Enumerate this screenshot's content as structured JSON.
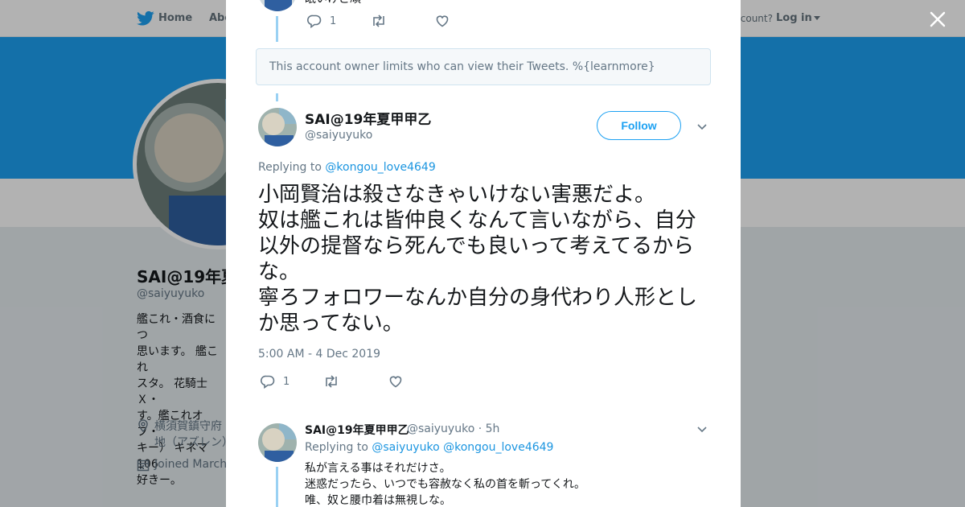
{
  "nav": {
    "home": "Home",
    "about": "Abo",
    "have_account": "account?",
    "login": "Log in"
  },
  "profile": {
    "name": "SAI@19年夏",
    "handle": "@saiyuyuko",
    "bio": "艦これ・酒食につ\n思います。 艦これ\nスタ。 花騎士Ｘ・\nす。艦これオフ・\nキー） キネマ106\n好きー。",
    "location": "横須賀鎮守府\n地（アズレン）",
    "joined": "Joined March"
  },
  "modal": {
    "previous_tweet": {
      "text": "眠いけど頑",
      "reply_count": "1"
    },
    "notice": "This account owner limits who can view their Tweets. %{learnmore}",
    "main_tweet": {
      "name": "SAI@19年夏甲甲乙",
      "handle": "@saiyuyuko",
      "follow_label": "Follow",
      "replying_prefix": "Replying to",
      "replying_to": "@kongou_love4649",
      "text": "小岡賢治は殺さなきゃいけない害悪だよ。\n奴は艦これは皆仲良くなんて言いながら、自分以外の提督なら死んでも良いって考えてるからな。\n寧ろフォロワーなんか自分の身代わり人形としか思ってない。",
      "timestamp": "5:00 AM - 4 Dec 2019",
      "reply_count": "1"
    },
    "reply_tweet": {
      "name": "SAI@19年夏甲甲乙",
      "handle_time": "@saiyuyuko · 5h",
      "replying_prefix": "Replying to",
      "replying_to_1": "@saiyuyuko",
      "replying_to_2": "@kongou_love4649",
      "text": "私が言える事はそれだけさ。\n迷惑だったら、いつでも容赦なく私の首を斬ってくれ。\n唯、奴と腰巾着は無視しな。"
    }
  },
  "colors": {
    "brand_blue": "#1da1f2",
    "link_blue": "#1b95e0",
    "thread_line": "#9ad1f3",
    "text_secondary": "#657786"
  },
  "icons": [
    "twitter-bird-icon",
    "close-icon",
    "reply-icon",
    "retweet-icon",
    "like-icon",
    "chevron-down-icon",
    "location-icon",
    "calendar-icon"
  ]
}
